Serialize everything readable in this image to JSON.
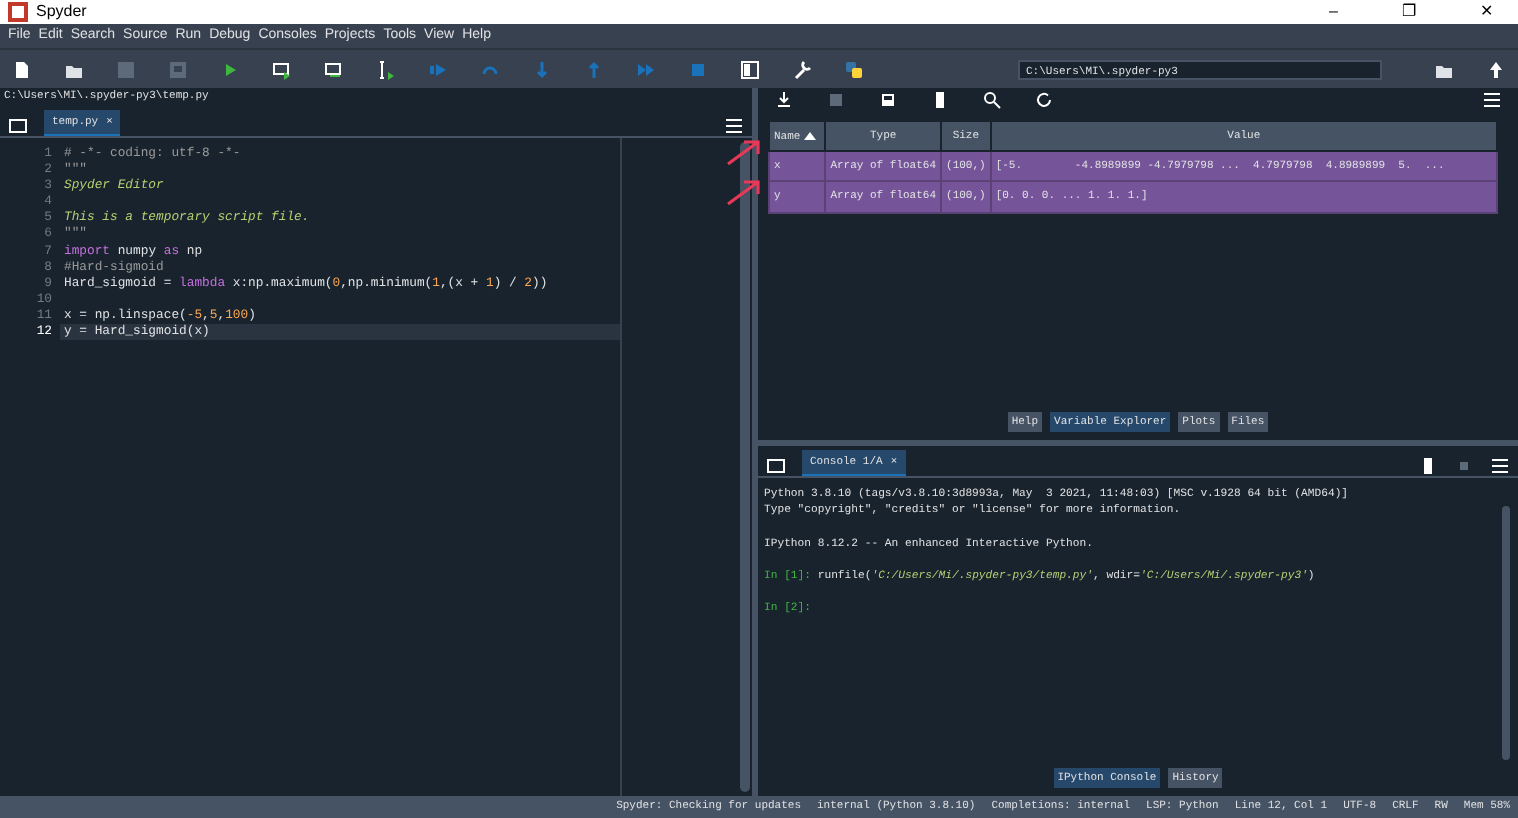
{
  "window": {
    "title": "Spyder",
    "controls": [
      "–",
      "❐",
      "✕"
    ]
  },
  "menu": [
    "File",
    "Edit",
    "Search",
    "Source",
    "Run",
    "Debug",
    "Consoles",
    "Projects",
    "Tools",
    "View",
    "Help"
  ],
  "toolbar": {
    "path": "C:\\Users\\MI\\.spyder-py3"
  },
  "editor": {
    "file_path": "C:\\Users\\MI\\.spyder-py3\\temp.py",
    "tabs": [
      {
        "label": "temp.py",
        "close": "×",
        "selected": true
      }
    ],
    "lines": [
      {
        "number": "1",
        "current": false,
        "tokens": [
          {
            "kind": "comment",
            "text": "# -*- coding: utf-8 -*-"
          }
        ]
      },
      {
        "number": "2",
        "current": false,
        "tokens": [
          {
            "kind": "comment",
            "text": "\"\"\""
          }
        ]
      },
      {
        "number": "3",
        "current": false,
        "tokens": [
          {
            "kind": "string",
            "text": "Spyder Editor"
          }
        ]
      },
      {
        "number": "4",
        "current": false
      },
      {
        "number": "5",
        "current": false,
        "tokens": [
          {
            "kind": "string",
            "text": "This is a temporary script file."
          }
        ]
      },
      {
        "number": "6",
        "current": false,
        "tokens": [
          {
            "kind": "comment",
            "text": "\"\"\""
          }
        ]
      },
      {
        "number": "7",
        "current": false,
        "tokens": [
          {
            "kind": "keyword",
            "text": "import"
          },
          {
            "kind": "plain",
            "text": " numpy "
          },
          {
            "kind": "keyword",
            "text": "as"
          },
          {
            "kind": "plain",
            "text": " np"
          }
        ]
      },
      {
        "number": "8",
        "current": false,
        "tokens": [
          {
            "kind": "comment",
            "text": "#Hard-sigmoid"
          }
        ]
      },
      {
        "number": "9",
        "current": false,
        "tokens": [
          {
            "kind": "plain",
            "text": "Hard_sigmoid = "
          },
          {
            "kind": "keyword",
            "text": "lambda"
          },
          {
            "kind": "plain",
            "text": " x:np.maximum("
          },
          {
            "kind": "number",
            "text": "0"
          },
          {
            "kind": "plain",
            "text": ",np.minimum("
          },
          {
            "kind": "number",
            "text": "1"
          },
          {
            "kind": "plain",
            "text": ",(x + "
          },
          {
            "kind": "number",
            "text": "1"
          },
          {
            "kind": "plain",
            "text": ") / "
          },
          {
            "kind": "number",
            "text": "2"
          },
          {
            "kind": "plain",
            "text": "))"
          }
        ]
      },
      {
        "number": "10",
        "current": false
      },
      {
        "number": "11",
        "current": false,
        "tokens": [
          {
            "kind": "plain",
            "text": "x = np.linspace("
          },
          {
            "kind": "number",
            "text": "-5"
          },
          {
            "kind": "plain",
            "text": ","
          },
          {
            "kind": "number",
            "text": "5"
          },
          {
            "kind": "plain",
            "text": ","
          },
          {
            "kind": "number",
            "text": "100"
          },
          {
            "kind": "plain",
            "text": ")"
          }
        ]
      },
      {
        "number": "12",
        "current": true,
        "tokens": [
          {
            "kind": "plain",
            "text": "y = Hard_sigmoid(x)"
          }
        ]
      }
    ]
  },
  "variable_explorer": {
    "columns": [
      {
        "label": "Name",
        "sorted": true
      },
      {
        "label": "Type",
        "sorted": false
      },
      {
        "label": "Size",
        "sorted": false
      },
      {
        "label": "Value",
        "sorted": false
      }
    ],
    "rows": [
      {
        "name": "x",
        "type": "Array of float64",
        "size": "(100,)",
        "value": "[-5.        -4.8989899 -4.7979798 ...  4.7979798  4.8989899  5.  ..."
      },
      {
        "name": "y",
        "type": "Array of float64",
        "size": "(100,)",
        "value": "[0. 0. 0. ... 1. 1. 1.]"
      }
    ]
  },
  "pane_tabs": [
    {
      "label": "Help",
      "selected": false
    },
    {
      "label": "Variable Explorer",
      "selected": true
    },
    {
      "label": "Plots",
      "selected": false
    },
    {
      "label": "Files",
      "selected": false
    }
  ],
  "console": {
    "tabs": [
      {
        "label": "Console 1/A",
        "close": "×",
        "selected": true
      }
    ],
    "paragraphs": [
      [
        [
          {
            "kind": "plain",
            "text": "Python 3.8.10 (tags/v3.8.10:3d8993a, May  3 2021, 11:48:03) [MSC v.1928 64 bit (AMD64)]"
          }
        ],
        [
          {
            "kind": "plain",
            "text": "Type \"copyright\", \"credits\" or \"license\" for more information."
          }
        ]
      ],
      [
        [
          {
            "kind": "plain",
            "text": "IPython 8.12.2 -- An enhanced Interactive Python."
          }
        ]
      ],
      [
        [
          {
            "kind": "prompt",
            "text": "In [1]:"
          },
          {
            "kind": "plain",
            "text": " runfile("
          },
          {
            "kind": "string",
            "text": "'C:/Users/Mi/.spyder-py3/temp.py'"
          },
          {
            "kind": "plain",
            "text": ", wdir="
          },
          {
            "kind": "string",
            "text": "'C:/Users/Mi/.spyder-py3'"
          },
          {
            "kind": "plain",
            "text": ")"
          }
        ]
      ],
      [
        [
          {
            "kind": "prompt",
            "text": "In [2]:"
          }
        ]
      ]
    ]
  },
  "bottom_tabs": [
    {
      "label": "IPython Console",
      "selected": true
    },
    {
      "label": "History",
      "selected": false
    }
  ],
  "status_bar": [
    "Spyder: Checking for updates",
    "internal (Python 3.8.10)",
    "Completions: internal",
    "LSP: Python",
    "Line 12, Col 1",
    "UTF-8",
    "CRLF",
    "RW",
    "Mem 58%"
  ]
}
